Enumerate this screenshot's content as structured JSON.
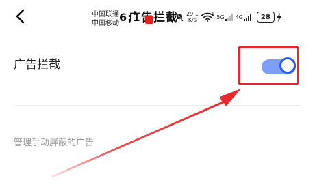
{
  "status_bar": {
    "carrier_1": "中国联通",
    "carrier_2": "中国移动",
    "time": "6:",
    "time_overlap": "1",
    "page_title": "广告拦截",
    "net_speed_value": "29.1",
    "net_speed_unit": "K/s",
    "wifi_tag": "6",
    "signal_5g": "5G",
    "signal_4g": "4G",
    "battery": "28"
  },
  "settings": {
    "ad_block_label": "广告拦截",
    "ad_block_enabled": true,
    "manage_link": "管理手动屏蔽的广告"
  },
  "colors": {
    "toggle_track": "#7e9ff7",
    "toggle_knob_border": "#2a5de8",
    "annotation": "#e8262b"
  }
}
